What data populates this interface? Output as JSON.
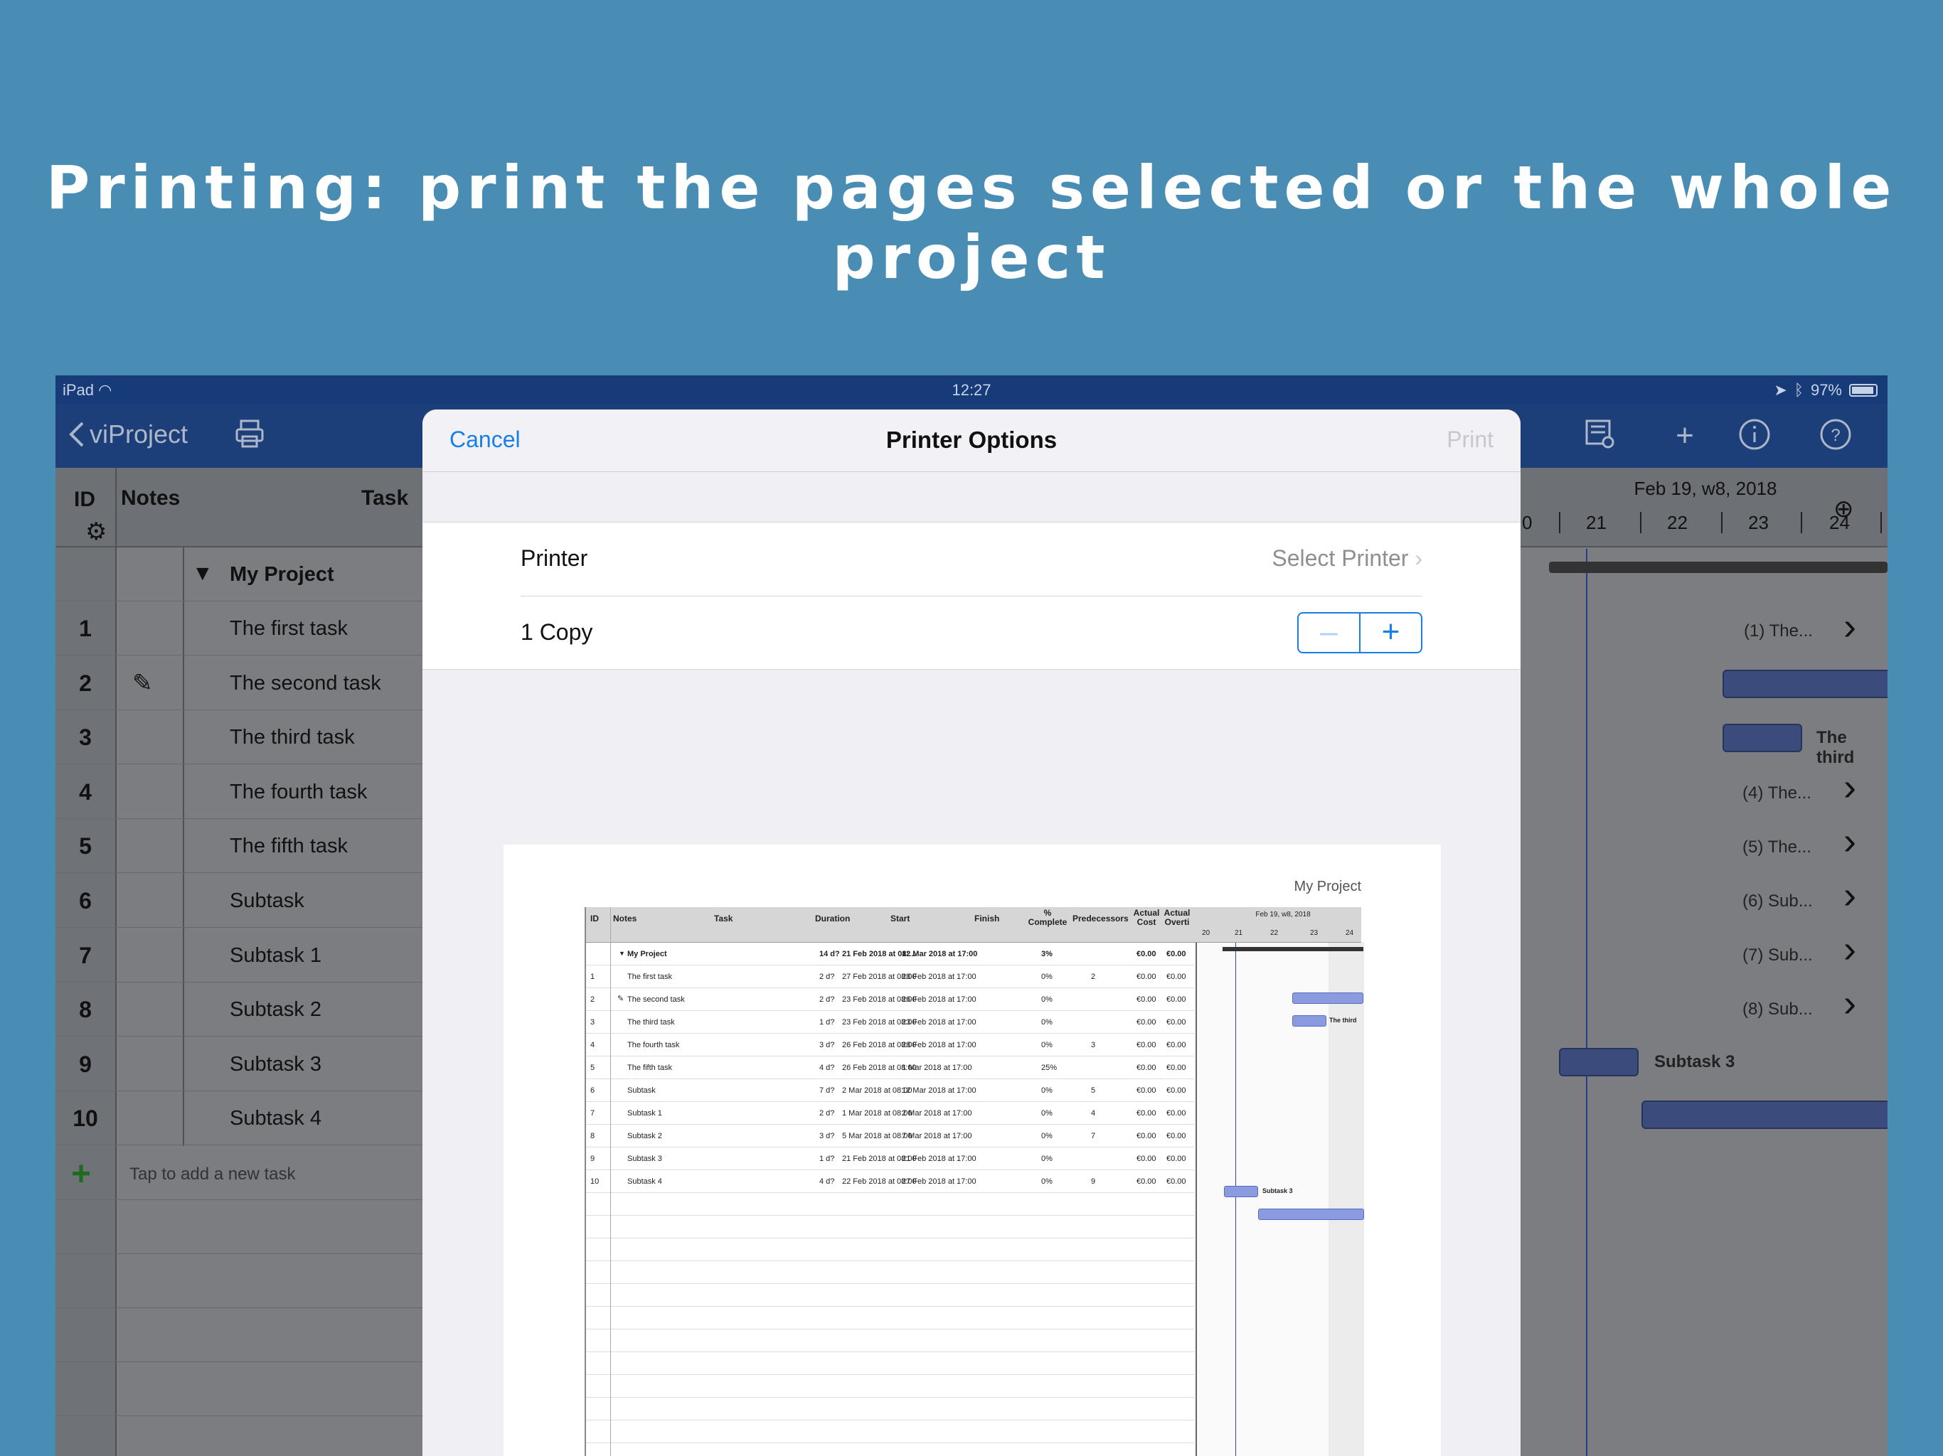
{
  "headline": "Printing: print the pages selected or the whole project",
  "status": {
    "device": "iPad",
    "time": "12:27",
    "battery": "97%"
  },
  "nav": {
    "back_label": "viProject"
  },
  "table": {
    "headers": {
      "id": "ID",
      "notes": "Notes",
      "task": "Task"
    },
    "project_row": "My Project",
    "rows": [
      {
        "id": "1",
        "task": "The first task"
      },
      {
        "id": "2",
        "task": "The second task"
      },
      {
        "id": "3",
        "task": "The third task"
      },
      {
        "id": "4",
        "task": "The fourth task"
      },
      {
        "id": "5",
        "task": "The fifth task"
      },
      {
        "id": "6",
        "task": "Subtask"
      },
      {
        "id": "7",
        "task": "Subtask 1"
      },
      {
        "id": "8",
        "task": "Subtask 2"
      },
      {
        "id": "9",
        "task": "Subtask 3"
      },
      {
        "id": "10",
        "task": "Subtask 4"
      }
    ],
    "add_task": "Tap to add a new task"
  },
  "gantt": {
    "date": "Feb 19, w8, 2018",
    "ticks": [
      "0",
      "21",
      "22",
      "23",
      "24"
    ],
    "labels": {
      "r1": "(1) The...",
      "r3": "The third",
      "r4": "(4) The...",
      "r5": "(5) The...",
      "r6": "(6) Sub...",
      "r7": "(7) Sub...",
      "r8": "(8) Sub...",
      "r9": "Subtask 3"
    }
  },
  "modal": {
    "cancel": "Cancel",
    "title": "Printer Options",
    "print": "Print",
    "printer_label": "Printer",
    "printer_value": "Select Printer",
    "copies_label": "1 Copy"
  },
  "preview": {
    "title": "My Project",
    "headers": [
      "ID",
      "Notes",
      "Task",
      "Duration",
      "Start",
      "Finish",
      "% Complete",
      "Predecessors",
      "Actual Cost",
      "Actual Overti"
    ],
    "gantt_date": "Feb 19, w8, 2018",
    "gantt_ticks": [
      "20",
      "21",
      "22",
      "23",
      "24"
    ],
    "rows": [
      {
        "id": "",
        "task": "My Project",
        "dur": "14 d?",
        "start": "21 Feb 2018 at 08:...",
        "finish": "12 Mar 2018 at 17:00",
        "pct": "3%",
        "pred": "",
        "cost": "€0.00",
        "ot": "€0.00"
      },
      {
        "id": "1",
        "task": "The first task",
        "dur": "2 d?",
        "start": "27 Feb 2018 at 08:00",
        "finish": "28 Feb 2018 at 17:00",
        "pct": "0%",
        "pred": "2",
        "cost": "€0.00",
        "ot": "€0.00"
      },
      {
        "id": "2",
        "task": "The second task",
        "dur": "2 d?",
        "start": "23 Feb 2018 at 08:00",
        "finish": "26 Feb 2018 at 17:00",
        "pct": "0%",
        "pred": "",
        "cost": "€0.00",
        "ot": "€0.00"
      },
      {
        "id": "3",
        "task": "The third task",
        "dur": "1 d?",
        "start": "23 Feb 2018 at 08:00",
        "finish": "23 Feb 2018 at 17:00",
        "pct": "0%",
        "pred": "",
        "cost": "€0.00",
        "ot": "€0.00"
      },
      {
        "id": "4",
        "task": "The fourth task",
        "dur": "3 d?",
        "start": "26 Feb 2018 at 08:00",
        "finish": "28 Feb 2018 at 17:00",
        "pct": "0%",
        "pred": "3",
        "cost": "€0.00",
        "ot": "€0.00"
      },
      {
        "id": "5",
        "task": "The fifth task",
        "dur": "4 d?",
        "start": "26 Feb 2018 at 08:00",
        "finish": "1 Mar 2018 at 17:00",
        "pct": "25%",
        "pred": "",
        "cost": "€0.00",
        "ot": "€0.00"
      },
      {
        "id": "6",
        "task": "Subtask",
        "dur": "7 d?",
        "start": "2 Mar 2018 at 08:00",
        "finish": "12 Mar 2018 at 17:00",
        "pct": "0%",
        "pred": "5",
        "cost": "€0.00",
        "ot": "€0.00"
      },
      {
        "id": "7",
        "task": "Subtask 1",
        "dur": "2 d?",
        "start": "1 Mar 2018 at 08:00",
        "finish": "2 Mar 2018 at 17:00",
        "pct": "0%",
        "pred": "4",
        "cost": "€0.00",
        "ot": "€0.00"
      },
      {
        "id": "8",
        "task": "Subtask 2",
        "dur": "3 d?",
        "start": "5 Mar 2018 at 08:00",
        "finish": "7 Mar 2018 at 17:00",
        "pct": "0%",
        "pred": "7",
        "cost": "€0.00",
        "ot": "€0.00"
      },
      {
        "id": "9",
        "task": "Subtask 3",
        "dur": "1 d?",
        "start": "21 Feb 2018 at 08:00",
        "finish": "21 Feb 2018 at 17:00",
        "pct": "0%",
        "pred": "",
        "cost": "€0.00",
        "ot": "€0.00"
      },
      {
        "id": "10",
        "task": "Subtask 4",
        "dur": "4 d?",
        "start": "22 Feb 2018 at 08:00",
        "finish": "27 Feb 2018 at 17:00",
        "pct": "0%",
        "pred": "9",
        "cost": "€0.00",
        "ot": "€0.00"
      }
    ],
    "bar_labels": {
      "r3": "The third",
      "r9": "Subtask 3"
    }
  }
}
